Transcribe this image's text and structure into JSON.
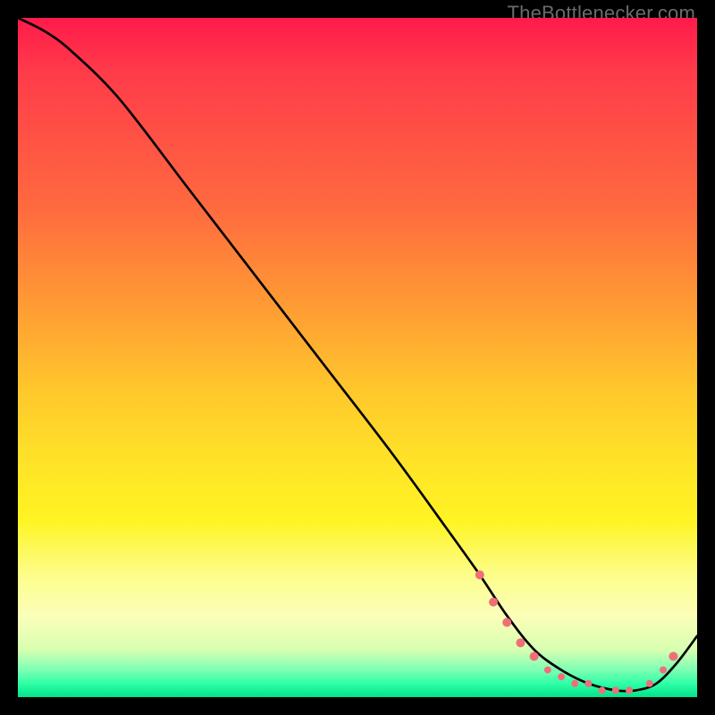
{
  "attribution": "TheBottlenecker.com",
  "colors": {
    "top": "#ff1a4b",
    "mid": "#ffe228",
    "bottom": "#00e38a",
    "curve": "#000000",
    "marker": "#ef6f78"
  },
  "chart_data": {
    "type": "line",
    "title": "",
    "xlabel": "",
    "ylabel": "",
    "xlim": [
      0,
      100
    ],
    "ylim": [
      0,
      100
    ],
    "series": [
      {
        "name": "bottleneck-curve",
        "x": [
          0,
          4,
          8,
          15,
          25,
          35,
          45,
          55,
          63,
          68,
          72,
          76,
          80,
          84,
          88,
          91,
          94,
          97,
          100
        ],
        "y": [
          100,
          98,
          95,
          88,
          75,
          62,
          49,
          36,
          25,
          18,
          12,
          7,
          4,
          2,
          1,
          1,
          2,
          5,
          9
        ]
      }
    ],
    "markers": [
      {
        "x": 68,
        "y": 18,
        "r": 5
      },
      {
        "x": 70,
        "y": 14,
        "r": 5
      },
      {
        "x": 72,
        "y": 11,
        "r": 5
      },
      {
        "x": 74,
        "y": 8,
        "r": 5
      },
      {
        "x": 76,
        "y": 6,
        "r": 5
      },
      {
        "x": 78,
        "y": 4,
        "r": 4
      },
      {
        "x": 80,
        "y": 3,
        "r": 4
      },
      {
        "x": 82,
        "y": 2,
        "r": 4
      },
      {
        "x": 84,
        "y": 2,
        "r": 4
      },
      {
        "x": 86,
        "y": 1,
        "r": 4
      },
      {
        "x": 88,
        "y": 1,
        "r": 4
      },
      {
        "x": 90,
        "y": 1,
        "r": 4
      },
      {
        "x": 93,
        "y": 2,
        "r": 4
      },
      {
        "x": 95,
        "y": 4,
        "r": 4
      },
      {
        "x": 96.5,
        "y": 6,
        "r": 5
      }
    ]
  }
}
